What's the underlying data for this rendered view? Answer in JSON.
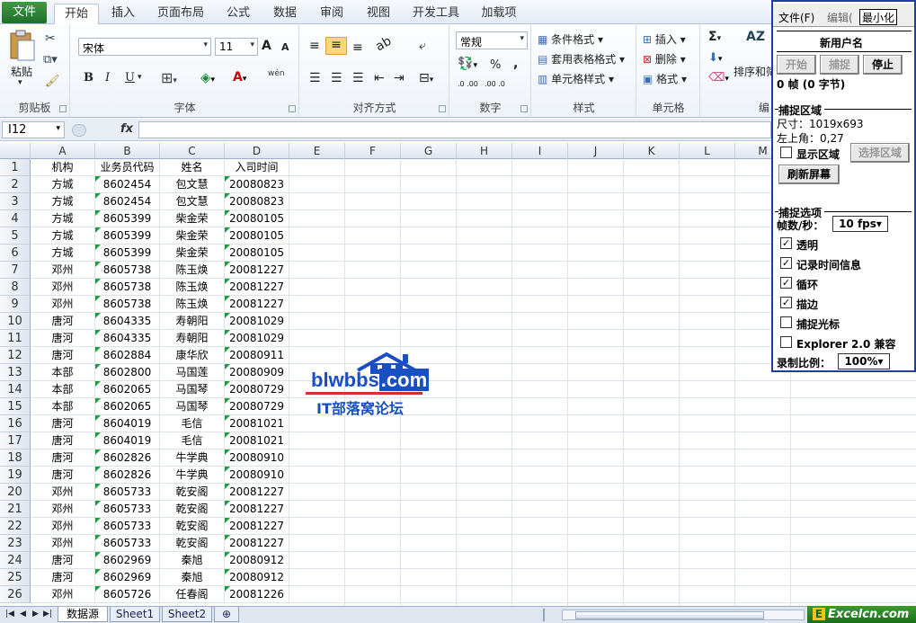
{
  "ribbon_tabs": [
    "文件",
    "开始",
    "插入",
    "页面布局",
    "公式",
    "数据",
    "审阅",
    "视图",
    "开发工具",
    "加载项"
  ],
  "clipboard": {
    "paste": "粘贴",
    "label": "剪贴板"
  },
  "font": {
    "name": "宋体",
    "size": "11",
    "label": "字体",
    "bold": "B",
    "italic": "I",
    "underline": "U",
    "a_big": "A",
    "a_small": "A",
    "wen": "wén"
  },
  "align": {
    "label": "对齐方式"
  },
  "number": {
    "format": "常规",
    "label": "数字",
    "percent": "%",
    "comma": ",",
    "dec_more": ".0 .00",
    "dec_less": ".00 .0"
  },
  "styles": {
    "cond": "条件格式",
    "table": "套用表格格式",
    "cell": "单元格样式",
    "label": "样式"
  },
  "cells": {
    "insert": "插入",
    "delete": "删除",
    "format": "格式",
    "label": "单元格"
  },
  "editing": {
    "sum": "Σ",
    "sort": "排序和筛",
    "label": "编"
  },
  "formula_bar": {
    "namebox": "I12",
    "fx": "fx",
    "value": ""
  },
  "columns": [
    "A",
    "B",
    "C",
    "D",
    "E",
    "F",
    "G",
    "H",
    "I",
    "J",
    "K",
    "L",
    "M"
  ],
  "rows": [
    {
      "n": "1",
      "a": "机构",
      "b": "业务员代码",
      "c": "姓名",
      "d": "入司时间"
    },
    {
      "n": "2",
      "a": "方城",
      "b": "8602454",
      "c": "包文慧",
      "d": "20080823"
    },
    {
      "n": "3",
      "a": "方城",
      "b": "8602454",
      "c": "包文慧",
      "d": "20080823"
    },
    {
      "n": "4",
      "a": "方城",
      "b": "8605399",
      "c": "柴金荣",
      "d": "20080105"
    },
    {
      "n": "5",
      "a": "方城",
      "b": "8605399",
      "c": "柴金荣",
      "d": "20080105"
    },
    {
      "n": "6",
      "a": "方城",
      "b": "8605399",
      "c": "柴金荣",
      "d": "20080105"
    },
    {
      "n": "7",
      "a": "邓州",
      "b": "8605738",
      "c": "陈玉焕",
      "d": "20081227"
    },
    {
      "n": "8",
      "a": "邓州",
      "b": "8605738",
      "c": "陈玉焕",
      "d": "20081227"
    },
    {
      "n": "9",
      "a": "邓州",
      "b": "8605738",
      "c": "陈玉焕",
      "d": "20081227"
    },
    {
      "n": "10",
      "a": "唐河",
      "b": "8604335",
      "c": "寿朝阳",
      "d": "20081029"
    },
    {
      "n": "11",
      "a": "唐河",
      "b": "8604335",
      "c": "寿朝阳",
      "d": "20081029"
    },
    {
      "n": "12",
      "a": "唐河",
      "b": "8602884",
      "c": "康华欣",
      "d": "20080911"
    },
    {
      "n": "13",
      "a": "本部",
      "b": "8602800",
      "c": "马国莲",
      "d": "20080909"
    },
    {
      "n": "14",
      "a": "本部",
      "b": "8602065",
      "c": "马国琴",
      "d": "20080729"
    },
    {
      "n": "15",
      "a": "本部",
      "b": "8602065",
      "c": "马国琴",
      "d": "20080729"
    },
    {
      "n": "16",
      "a": "唐河",
      "b": "8604019",
      "c": "毛信",
      "d": "20081021"
    },
    {
      "n": "17",
      "a": "唐河",
      "b": "8604019",
      "c": "毛信",
      "d": "20081021"
    },
    {
      "n": "18",
      "a": "唐河",
      "b": "8602826",
      "c": "牛学典",
      "d": "20080910"
    },
    {
      "n": "19",
      "a": "唐河",
      "b": "8602826",
      "c": "牛学典",
      "d": "20080910"
    },
    {
      "n": "20",
      "a": "邓州",
      "b": "8605733",
      "c": "乾安阁",
      "d": "20081227"
    },
    {
      "n": "21",
      "a": "邓州",
      "b": "8605733",
      "c": "乾安阁",
      "d": "20081227"
    },
    {
      "n": "22",
      "a": "邓州",
      "b": "8605733",
      "c": "乾安阁",
      "d": "20081227"
    },
    {
      "n": "23",
      "a": "邓州",
      "b": "8605733",
      "c": "乾安阁",
      "d": "20081227"
    },
    {
      "n": "24",
      "a": "唐河",
      "b": "8602969",
      "c": "秦旭",
      "d": "20080912"
    },
    {
      "n": "25",
      "a": "唐河",
      "b": "8602969",
      "c": "秦旭",
      "d": "20080912"
    },
    {
      "n": "26",
      "a": "邓州",
      "b": "8605726",
      "c": "任春阁",
      "d": "20081226"
    }
  ],
  "sheets": [
    "数据源",
    "Sheet1",
    "Sheet2"
  ],
  "watermark": {
    "domain": "blwbbs",
    "tld": ".com",
    "subtitle": "IT部落窝论坛"
  },
  "brand": {
    "mark": "E",
    "text": "Excelcn.com"
  },
  "recorder": {
    "menu_file": "文件(F)",
    "menu_edit": "编辑(",
    "minimize": "最小化",
    "user": "新用户名",
    "btn_start": "开始",
    "btn_capture": "捕捉",
    "btn_stop": "停止",
    "frames": "0 帧 (0 字节)",
    "sec_area": "捕捉区域",
    "size": "尺寸：1019x693",
    "corner": "左上角：0,27",
    "show_area": "显示区域",
    "select_area": "选择区域",
    "refresh": "刷新屏幕",
    "sec_options": "捕捉选项",
    "fps_label": "帧数/秒：",
    "fps": "10 fps",
    "opt_transparent": "透明",
    "opt_time": "记录时间信息",
    "opt_loop": "循环",
    "opt_border": "描边",
    "opt_cursor": "捕捉光标",
    "opt_explorer": "Explorer 2.0 兼容",
    "scale_label": "录制比例：",
    "scale": "100%"
  },
  "colors": {
    "accent": "#1f3d9c",
    "file_tab": "#2a7f33",
    "green_triangle": "#1e9e3a",
    "watermark_blue": "#1a4fc4",
    "watermark_red": "#d23030"
  }
}
